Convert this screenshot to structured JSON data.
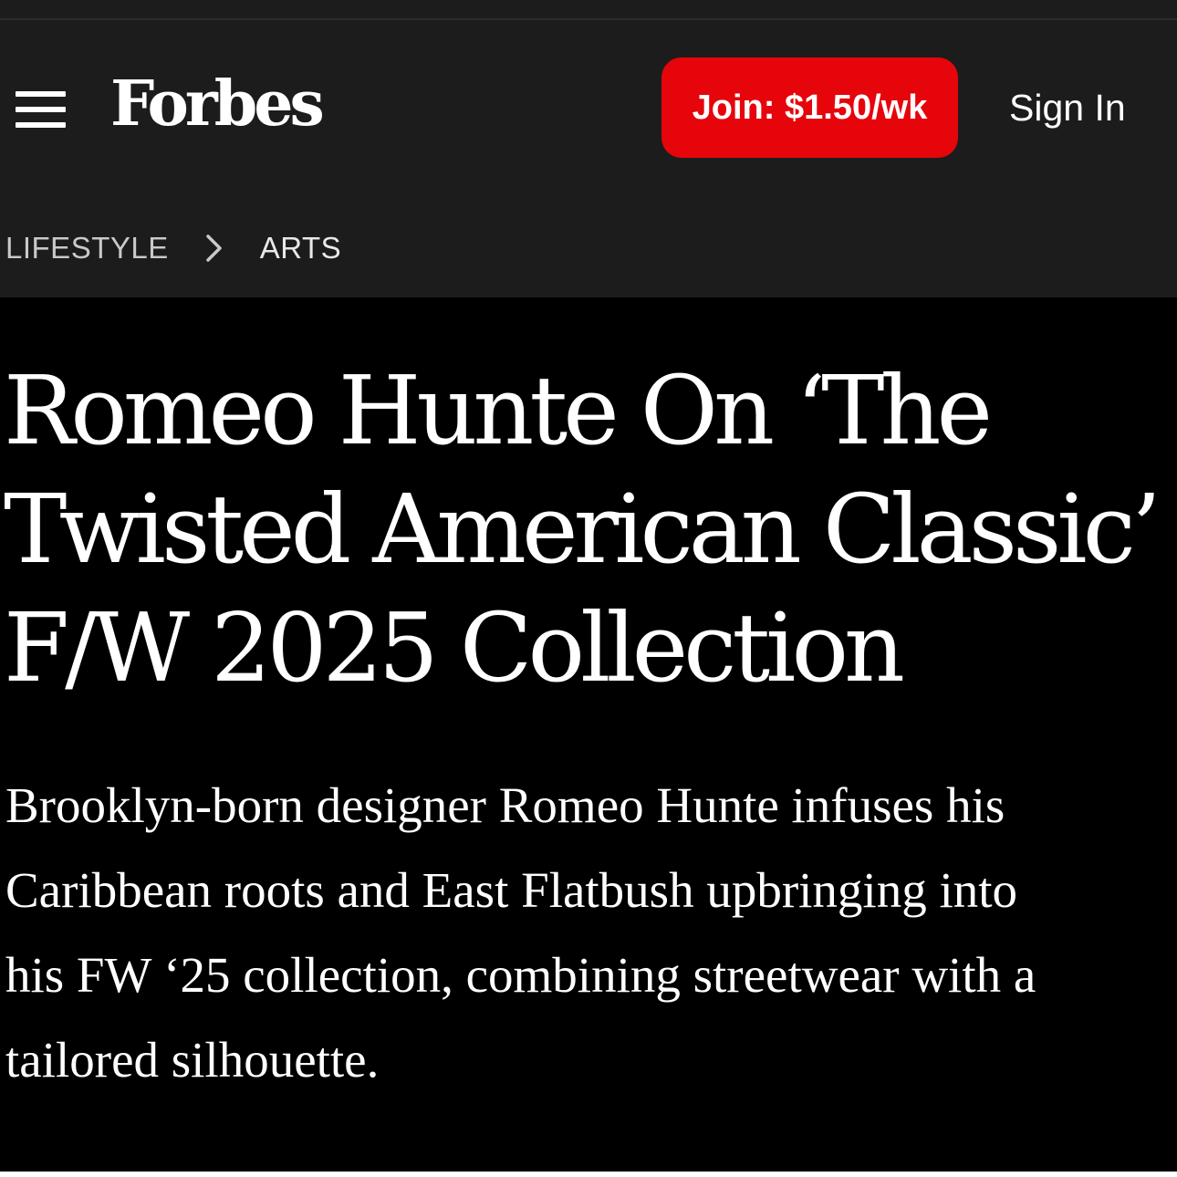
{
  "header": {
    "menu_icon": "hamburger-menu-icon",
    "logo_text": "Forbes",
    "join_label": "Join: $1.50/wk",
    "signin_label": "Sign In"
  },
  "breadcrumb": {
    "items": [
      "LIFESTYLE",
      "ARTS"
    ],
    "separator_icon": "chevron-right-icon"
  },
  "article": {
    "headline_lines": [
      "Romeo Hunte On ‘The",
      "Twisted American Classic’",
      "F/W 2025 Collection"
    ],
    "dek_lines": [
      "Brooklyn-born designer Romeo Hunte infuses his",
      "Caribbean roots and East Flatbush upbringing into",
      "his FW ‘25 collection, combining streetwear with a",
      "tailored silhouette."
    ]
  },
  "colors": {
    "header_bg": "#1c1c1c",
    "page_bg": "#000000",
    "join_button_bg": "#e5050b",
    "text": "#ffffff"
  }
}
